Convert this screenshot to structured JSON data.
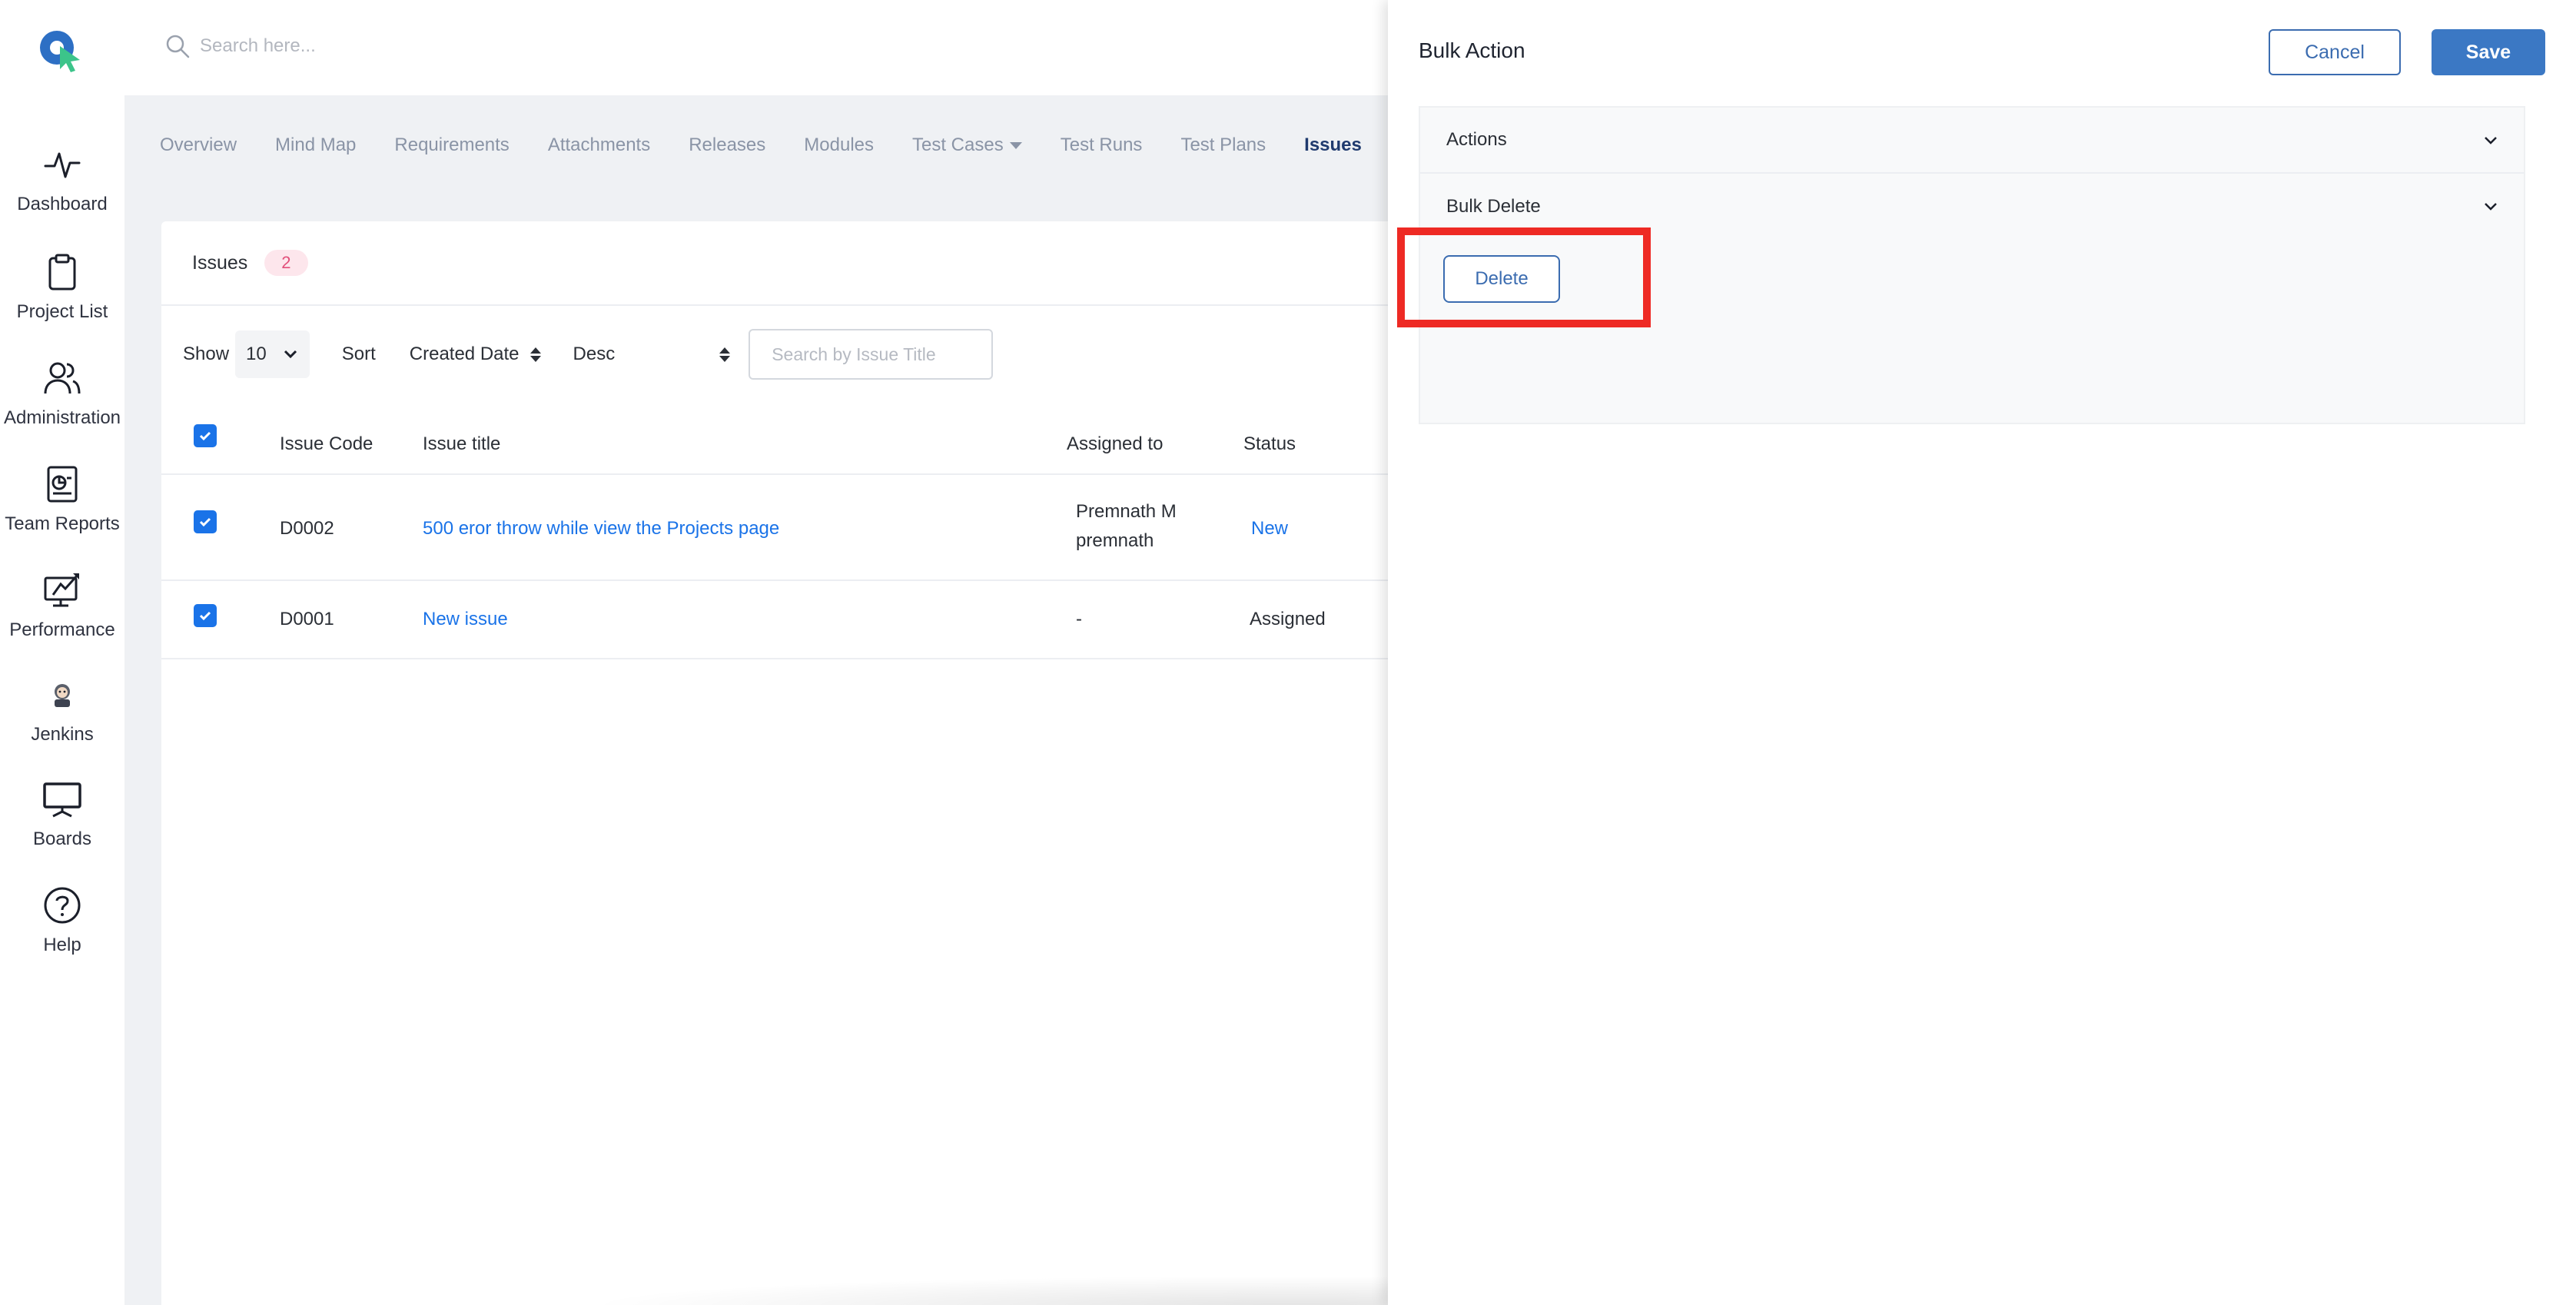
{
  "sidebar": {
    "items": [
      {
        "label": "Dashboard",
        "icon": "pulse-icon"
      },
      {
        "label": "Project List",
        "icon": "clipboard-icon"
      },
      {
        "label": "Administration",
        "icon": "users-icon"
      },
      {
        "label": "Team Reports",
        "icon": "report-icon"
      },
      {
        "label": "Performance",
        "icon": "performance-icon"
      },
      {
        "label": "Jenkins",
        "icon": "jenkins-icon"
      },
      {
        "label": "Boards",
        "icon": "board-icon"
      },
      {
        "label": "Help",
        "icon": "help-icon"
      }
    ]
  },
  "topbar": {
    "search_placeholder": "Search here..."
  },
  "tabs": [
    {
      "label": "Overview",
      "active": false
    },
    {
      "label": "Mind Map",
      "active": false
    },
    {
      "label": "Requirements",
      "active": false
    },
    {
      "label": "Attachments",
      "active": false
    },
    {
      "label": "Releases",
      "active": false
    },
    {
      "label": "Modules",
      "active": false
    },
    {
      "label": "Test Cases",
      "active": false,
      "dropdown": true
    },
    {
      "label": "Test Runs",
      "active": false
    },
    {
      "label": "Test Plans",
      "active": false
    },
    {
      "label": "Issues",
      "active": true
    }
  ],
  "issues": {
    "title": "Issues",
    "count": "2",
    "show_label": "Show",
    "show_value": "10",
    "sort_label": "Sort",
    "sort_field": "Created Date",
    "sort_order": "Desc",
    "search_placeholder": "Search by Issue Title",
    "columns": {
      "code": "Issue Code",
      "title": "Issue title",
      "assigned": "Assigned to",
      "status": "Status"
    },
    "rows": [
      {
        "code": "D0002",
        "title": "500 eror throw while view the Projects page",
        "assigned_line1": "Premnath M",
        "assigned_line2": "premnath",
        "status": "New",
        "checked": true
      },
      {
        "code": "D0001",
        "title": "New issue",
        "assigned_line1": "-",
        "assigned_line2": "",
        "status": "Assigned",
        "checked": true
      }
    ]
  },
  "panel": {
    "title": "Bulk Action",
    "cancel_label": "Cancel",
    "save_label": "Save",
    "sections": [
      {
        "label": "Actions"
      },
      {
        "label": "Bulk Delete"
      }
    ],
    "delete_label": "Delete"
  },
  "colors": {
    "accent": "#1a73e8",
    "primary_button": "#3b78c4",
    "highlight": "#ee2a24",
    "badge_bg": "#fde6ec",
    "badge_text": "#e2507a"
  }
}
